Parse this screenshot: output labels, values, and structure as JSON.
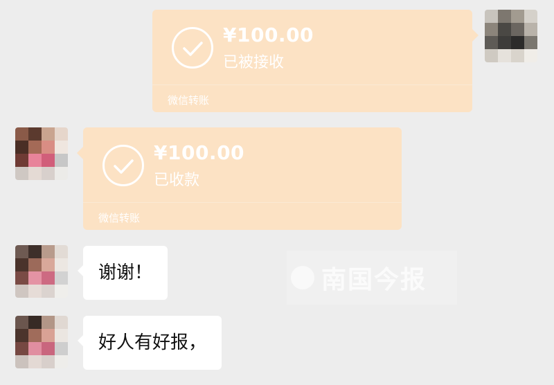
{
  "messages": [
    {
      "side": "right",
      "type": "transfer",
      "amount": "¥100.00",
      "status": "已被接收",
      "footer": "微信转账"
    },
    {
      "side": "left",
      "type": "transfer",
      "amount": "¥100.00",
      "status": "已收款",
      "footer": "微信转账"
    },
    {
      "side": "left",
      "type": "text",
      "text": "谢谢！"
    },
    {
      "side": "left",
      "type": "text",
      "text": "好人有好报，"
    }
  ],
  "watermark": {
    "text": "南国今报"
  },
  "colors": {
    "background": "#ededed",
    "transfer_bubble": "#fce2c4",
    "text_bubble": "#ffffff"
  },
  "icons": {
    "check": "check-circle-icon",
    "avatar": "pixelated-avatar"
  }
}
